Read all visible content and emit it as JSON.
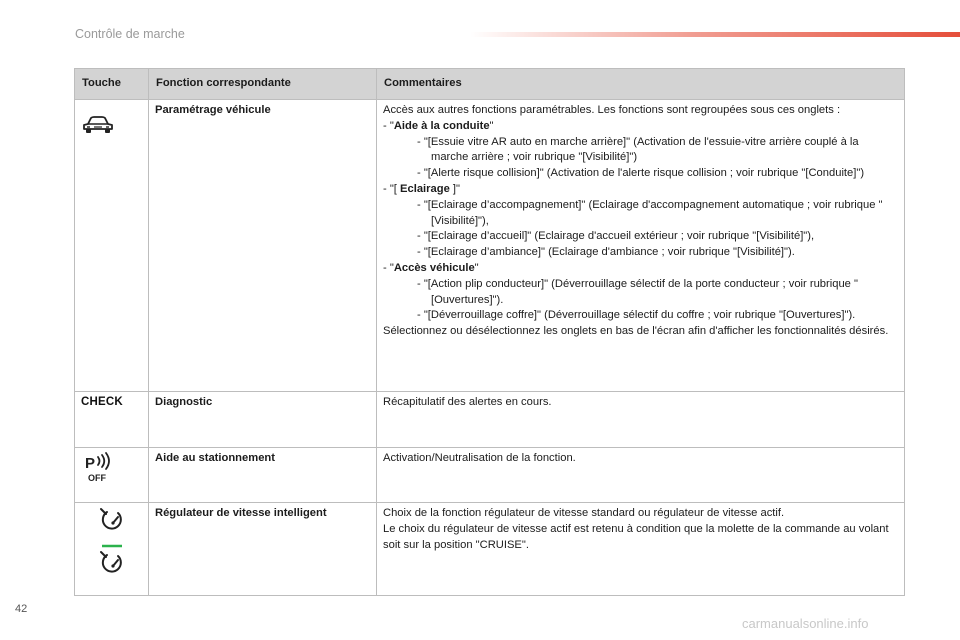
{
  "header": {
    "title": "Contrôle de marche"
  },
  "table": {
    "headers": {
      "col1": "Touche",
      "col2": "Fonction correspondante",
      "col3": "Commentaires"
    },
    "rows": {
      "vehicle": {
        "icon": "car-icon",
        "function": "Paramétrage véhicule",
        "intro": "Accès aux autres fonctions paramétrables. Les fonctions sont regroupées sous ces onglets :",
        "groups": [
          {
            "prefix": "- \"",
            "name": "Aide à la conduite",
            "suffix": "\"",
            "items": [
              "- \"[Essuie vitre AR auto en marche arrière]\" (Activation de l'essuie-vitre arrière couplé à la marche arrière ; voir rubrique \"[Visibilité]\")",
              "- \"[Alerte risque collision]\" (Activation de l'alerte risque collision ; voir rubrique \"[Conduite]\")"
            ]
          },
          {
            "prefix": "- \"[ ",
            "name": "Eclairage",
            "suffix": " ]\"",
            "items": [
              "- \"[Eclairage d’accompagnement]\" (Eclairage d'accompagnement automatique ; voir rubrique \"[Visibilité]\"),",
              "- \"[Eclairage d’accueil]\" (Eclairage d'accueil extérieur ; voir rubrique \"[Visibilité]\"),",
              "- \"[Eclairage d’ambiance]\" (Eclairage d'ambiance ; voir rubrique \"[Visibilité]\")."
            ]
          },
          {
            "prefix": "- \"",
            "name": "Accès véhicule",
            "suffix": "\"",
            "items": [
              "- \"[Action plip conducteur]\" (Déverrouillage sélectif de la porte conducteur ; voir rubrique \"[Ouvertures]\").",
              "- \"[Déverrouillage coffre]\" (Déverrouillage sélectif du coffre ; voir rubrique \"[Ouvertures]\")."
            ]
          }
        ],
        "outro": "Sélectionnez ou désélectionnez les onglets en bas de l'écran afin d'afficher les fonctionnalités désirés."
      },
      "diagnostic": {
        "icon_text": "CHECK",
        "function": "Diagnostic",
        "comment": "Récapitulatif des alertes en cours."
      },
      "parking": {
        "icon": "parking-sensor-off-icon",
        "icon_label": "OFF",
        "function": "Aide au stationnement",
        "comment": "Activation/Neutralisation de la fonction."
      },
      "cruise": {
        "icon": "speed-regulator-icon",
        "function": "Régulateur de vitesse intelligent",
        "comment_1": "Choix de la fonction régulateur de vitesse standard ou régulateur de vitesse actif.",
        "comment_2": "Le choix du régulateur de vitesse actif est retenu à condition que la molette de la commande au volant soit sur la position \"CRUISE\"."
      }
    }
  },
  "footer": {
    "page_number": "42",
    "watermark": "carmanualsonline.info"
  },
  "colors": {
    "accent": "#e54e3a",
    "header_bg": "#d3d3d3",
    "active_green": "#2bb24c"
  }
}
